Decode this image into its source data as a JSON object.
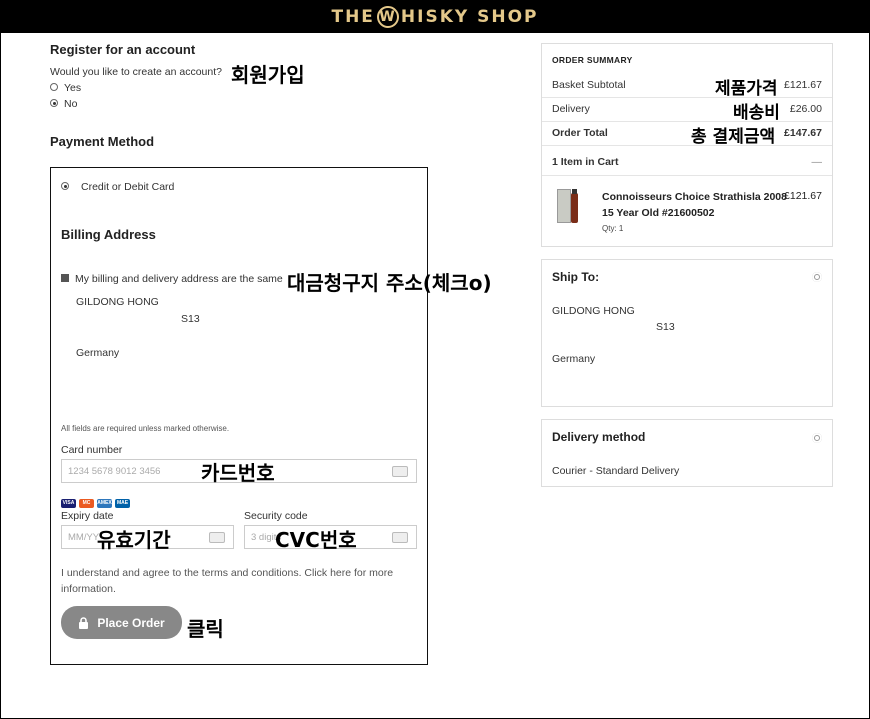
{
  "brand": {
    "logo_pre": "THE ",
    "logo_w": "W",
    "logo_post": "HISKY SHOP"
  },
  "register": {
    "title": "Register for an account",
    "question": "Would you like to create an account?",
    "yes": "Yes",
    "no": "No",
    "annotation": "회원가입"
  },
  "payment": {
    "title": "Payment Method",
    "option": "Credit or Debit Card",
    "billing_title": "Billing Address",
    "same_address_label": "My billing and delivery address are the same",
    "annotation_same": "대금청구지 주소(체크o)",
    "name": "GILDONG HONG",
    "postcode": "S13",
    "country": "Germany",
    "required_note": "All fields are required unless marked otherwise.",
    "card_label": "Card number",
    "card_placeholder": "1234 5678 9012 3456",
    "annotation_card": "카드번호",
    "brands": [
      "VISA",
      "MC",
      "AMEX",
      "MAE"
    ],
    "expiry_label": "Expiry date",
    "expiry_placeholder": "MM/YY",
    "annotation_expiry": "유효기간",
    "security_label": "Security code",
    "security_placeholder": "3 digits",
    "annotation_cvc": "CVC번호",
    "terms": "I understand and agree to the terms and conditions. Click here for more information.",
    "place_order": "Place Order",
    "annotation_click": "클릭"
  },
  "summary": {
    "title": "ORDER SUMMARY",
    "subtotal_label": "Basket Subtotal",
    "subtotal_annot": "제품가격",
    "subtotal": "£121.67",
    "delivery_label": "Delivery",
    "delivery_annot": "배송비",
    "delivery": "£26.00",
    "total_label": "Order Total",
    "total_annot": "총 결제금액",
    "total": "£147.67",
    "items_label": "1 Item in Cart",
    "collapse": "—",
    "product_line1": "Connoisseurs Choice Strathisla 2008",
    "product_line2": "15 Year Old #21600502",
    "product_price": "£121.67",
    "qty": "Qty: 1"
  },
  "ship": {
    "title": "Ship To:",
    "name": "GILDONG HONG",
    "postcode": "S13",
    "country": "Germany"
  },
  "delivery_method": {
    "title": "Delivery method",
    "value": "Courier - Standard Delivery"
  },
  "colors": {
    "logo": "#e4c88a",
    "button": "#888888"
  }
}
